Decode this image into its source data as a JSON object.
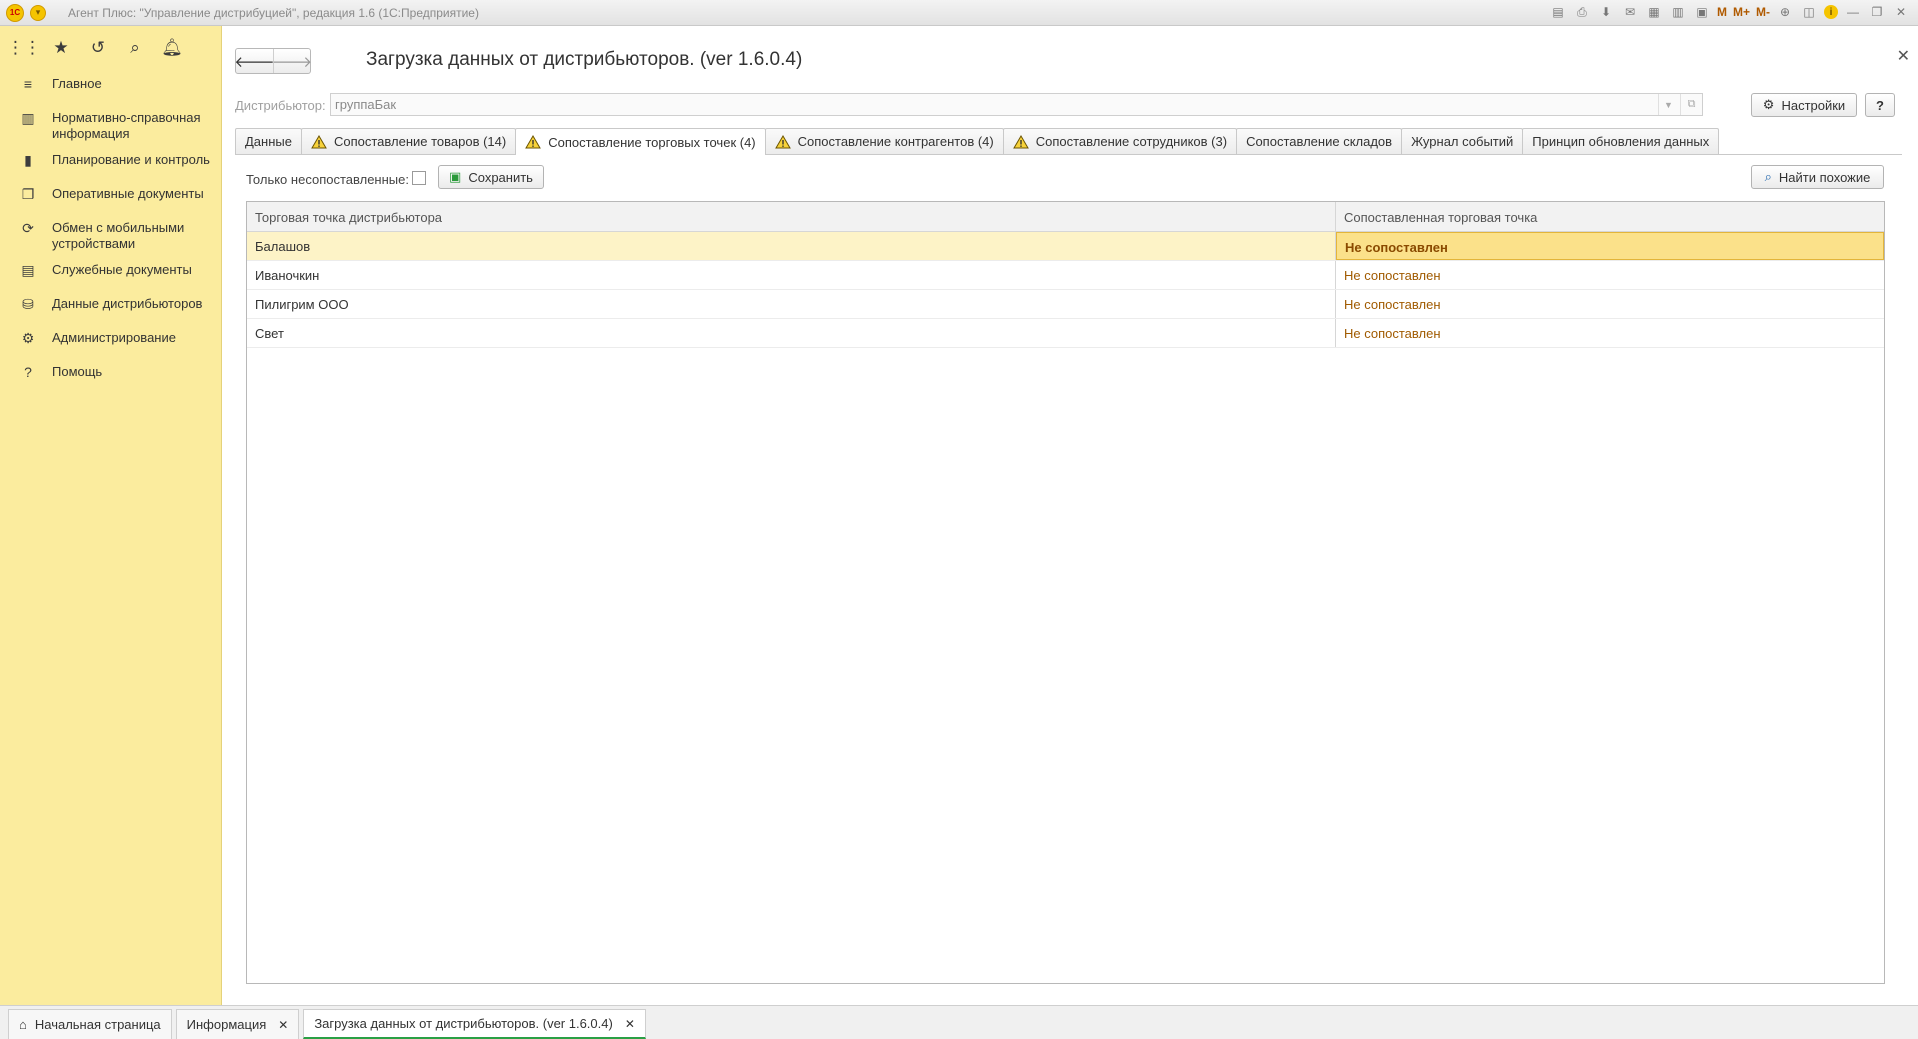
{
  "app": {
    "title": "Агент Плюс: \"Управление дистрибуцией\", редакция 1.6  (1С:Предприятие)",
    "logo_text": "1С",
    "toolbar_m": "M",
    "toolbar_mplus": "M+",
    "toolbar_mminus": "M-"
  },
  "sidebar": {
    "items": [
      {
        "label": "Главное",
        "icon": "list-icon"
      },
      {
        "label": "Нормативно-справочная информация",
        "icon": "book-icon"
      },
      {
        "label": "Планирование и контроль",
        "icon": "bar-chart-icon"
      },
      {
        "label": "Оперативные документы",
        "icon": "documents-icon"
      },
      {
        "label": "Обмен с мобильными устройствами",
        "icon": "sync-icon"
      },
      {
        "label": "Служебные документы",
        "icon": "service-docs-icon"
      },
      {
        "label": "Данные дистрибьюторов",
        "icon": "distributor-data-icon"
      },
      {
        "label": "Администрирование",
        "icon": "gear-icon"
      },
      {
        "label": "Помощь",
        "icon": "help-icon"
      }
    ]
  },
  "form": {
    "title": "Загрузка данных от дистрибьюторов. (ver 1.6.0.4)",
    "distributor_label": "Дистрибьютор:",
    "distributor_value": "группаБак",
    "settings_label": "Настройки",
    "help_label": "?",
    "tabs": [
      {
        "label": "Данные",
        "warn": false
      },
      {
        "label": "Сопоставление товаров (14)",
        "warn": true
      },
      {
        "label": "Сопоставление торговых точек (4)",
        "warn": true
      },
      {
        "label": "Сопоставление контрагентов (4)",
        "warn": true
      },
      {
        "label": "Сопоставление сотрудников (3)",
        "warn": true
      },
      {
        "label": "Сопоставление складов",
        "warn": false
      },
      {
        "label": "Журнал событий",
        "warn": false
      },
      {
        "label": "Принцип обновления данных",
        "warn": false
      }
    ],
    "filter_label": "Только несопоставленные:",
    "save_label": "Сохранить",
    "find_label": "Найти похожие"
  },
  "table": {
    "columns": [
      "Торговая точка дистрибьютора",
      "Сопоставленная торговая точка"
    ],
    "rows": [
      {
        "outlet": "Балашов",
        "matched": "Не сопоставлен"
      },
      {
        "outlet": "Иваночкин",
        "matched": "Не сопоставлен"
      },
      {
        "outlet": "Пилигрим ООО",
        "matched": "Не сопоставлен"
      },
      {
        "outlet": "Свет",
        "matched": "Не сопоставлен"
      }
    ]
  },
  "taskbar": {
    "tabs": [
      {
        "label": "Начальная страница"
      },
      {
        "label": "Информация"
      },
      {
        "label": "Загрузка данных от дистрибьюторов. (ver 1.6.0.4)"
      }
    ]
  },
  "colors": {
    "sidebar_bg": "#fbec9e",
    "accent_yellow": "#f5c400",
    "unmatched_text": "#a05a00",
    "selected_row": "#fdf3c7",
    "active_tab_underline": "#2aa045"
  }
}
